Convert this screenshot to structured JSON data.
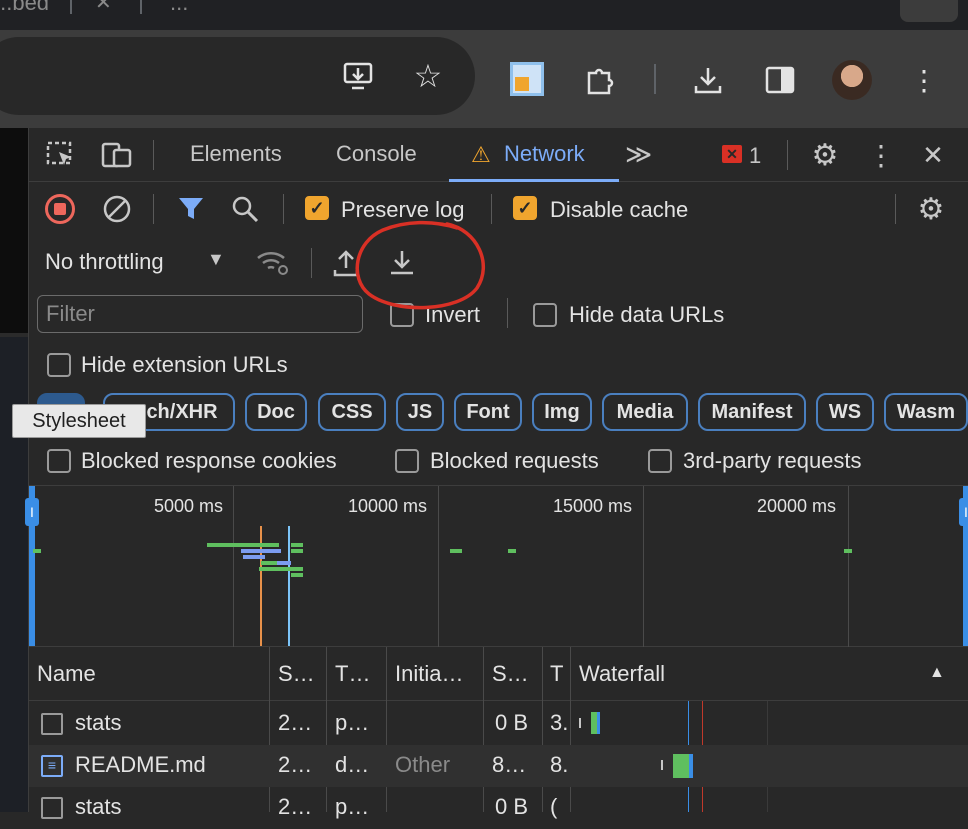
{
  "tabstrip": {
    "fragment_1": "...bed",
    "fragment_2": "..."
  },
  "toolbar": {
    "icons": [
      "install-app-icon",
      "bookmark-star-icon",
      "extension-puzzle-icon",
      "download-icon",
      "side-panel-icon",
      "profile-avatar",
      "more-vertical-icon"
    ]
  },
  "devtools": {
    "tabs": {
      "elements": "Elements",
      "console": "Console",
      "network": "Network",
      "more": "≫"
    },
    "error_count": "1",
    "preserve_log": {
      "label": "Preserve log",
      "checked": true
    },
    "disable_cache": {
      "label": "Disable cache",
      "checked": true
    },
    "throttling": {
      "value": "No throttling"
    },
    "filter": {
      "placeholder": "Filter",
      "value": ""
    },
    "invert": {
      "label": "Invert",
      "checked": false
    },
    "hide_data_urls": {
      "label": "Hide data URLs",
      "checked": false
    },
    "hide_extension_urls": {
      "label": "Hide extension URLs",
      "checked": false
    },
    "type_chips": [
      "Fetch/XHR",
      "Doc",
      "CSS",
      "JS",
      "Font",
      "Img",
      "Media",
      "Manifest",
      "WS",
      "Wasm"
    ],
    "type_chip_first_visible": "ch/XHR",
    "tooltip": "Stylesheet",
    "blocked_response_cookies": {
      "label": "Blocked response cookies",
      "checked": false
    },
    "blocked_requests": {
      "label": "Blocked requests",
      "checked": false
    },
    "third_party": {
      "label": "3rd-party requests",
      "checked": false
    },
    "overview_ticks": [
      "5000 ms",
      "10000 ms",
      "15000 ms",
      "20000 ms"
    ],
    "columns": {
      "name": "Name",
      "status": "S…",
      "type": "T…",
      "initiator": "Initia…",
      "size": "S…",
      "time": "T",
      "waterfall": "Waterfall"
    },
    "rows": [
      {
        "name": "stats",
        "status": "2…",
        "type": "p…",
        "initiator": "",
        "size": "0 B",
        "time": "3."
      },
      {
        "name": "README.md",
        "status": "2…",
        "type": "d…",
        "initiator": "Other",
        "size": "8…",
        "time": "8."
      },
      {
        "name": "stats",
        "status": "2…",
        "type": "p…",
        "initiator": "",
        "size": "0 B",
        "time": "("
      }
    ]
  },
  "colors": {
    "accent": "#7cacf8",
    "checkbox": "#f0a52e",
    "error": "#d93025",
    "annotation": "#d93025"
  }
}
